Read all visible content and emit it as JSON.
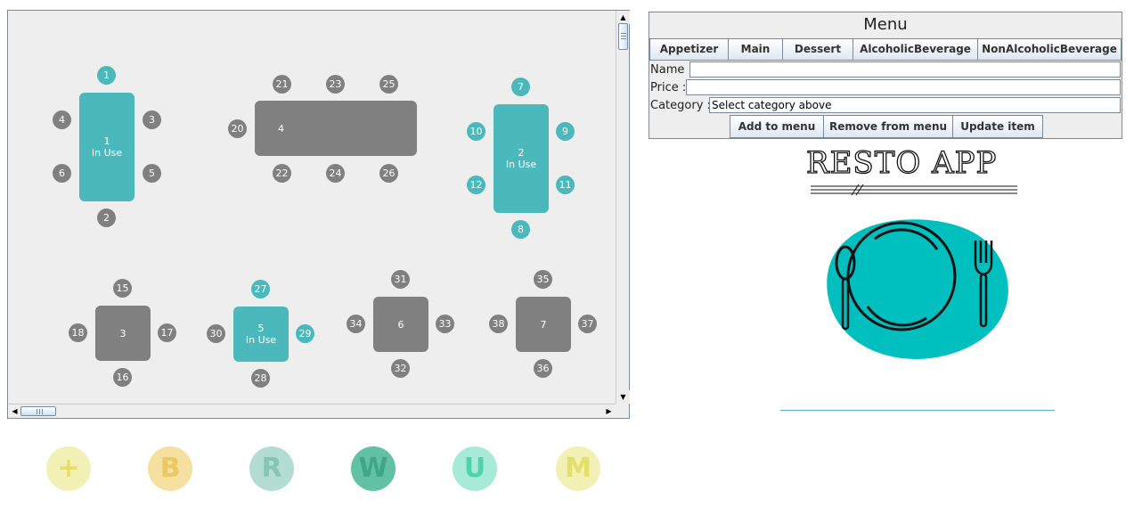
{
  "floor": {
    "tables": [
      {
        "id": "t1",
        "label": "1",
        "status": "In Use"
      },
      {
        "id": "t2",
        "label": "2",
        "status": "In Use"
      },
      {
        "id": "t3",
        "label": "3",
        "status": ""
      },
      {
        "id": "t4",
        "label": "4",
        "status": ""
      },
      {
        "id": "t5",
        "label": "5",
        "status": "In Use"
      },
      {
        "id": "t6",
        "label": "6",
        "status": ""
      },
      {
        "id": "t7",
        "label": "7",
        "status": ""
      }
    ],
    "seats": [
      "1",
      "2",
      "3",
      "4",
      "5",
      "6",
      "7",
      "8",
      "9",
      "10",
      "11",
      "12",
      "15",
      "16",
      "17",
      "18",
      "20",
      "21",
      "22",
      "23",
      "24",
      "25",
      "26",
      "27",
      "28",
      "29",
      "30",
      "31",
      "32",
      "33",
      "34",
      "35",
      "36",
      "37",
      "38"
    ],
    "scroll_up": "▲",
    "scroll_down": "▼",
    "scroll_left": "◀",
    "scroll_right": "▶"
  },
  "menu": {
    "title": "Menu",
    "categories": [
      "Appetizer",
      "Main",
      "Dessert",
      "AlcoholicBeverage",
      "NonAlcoholicBeverage"
    ],
    "name_label": "Name :",
    "name_value": "",
    "price_label": "Price :",
    "price_value": "",
    "category_label": "Category :",
    "category_value": "Select category above",
    "add_label": "Add to menu",
    "remove_label": "Remove from menu",
    "update_label": "Update item"
  },
  "logo": {
    "title": "RESTO APP",
    "icon": "plate-fork-spoon-icon",
    "accent": "#00bfbf"
  },
  "legend": [
    {
      "letter": "+",
      "bg": "#f2f0b4",
      "fg": "#e3e06a"
    },
    {
      "letter": "B",
      "bg": "#f6e0a0",
      "fg": "#ecc862"
    },
    {
      "letter": "R",
      "bg": "#b3dcd2",
      "fg": "#86c4b4"
    },
    {
      "letter": "W",
      "bg": "#62c1a2",
      "fg": "#3fa786"
    },
    {
      "letter": "U",
      "bg": "#a6ead7",
      "fg": "#4fd3ad"
    },
    {
      "letter": "M",
      "bg": "#f2f0b4",
      "fg": "#e3e06a"
    }
  ]
}
